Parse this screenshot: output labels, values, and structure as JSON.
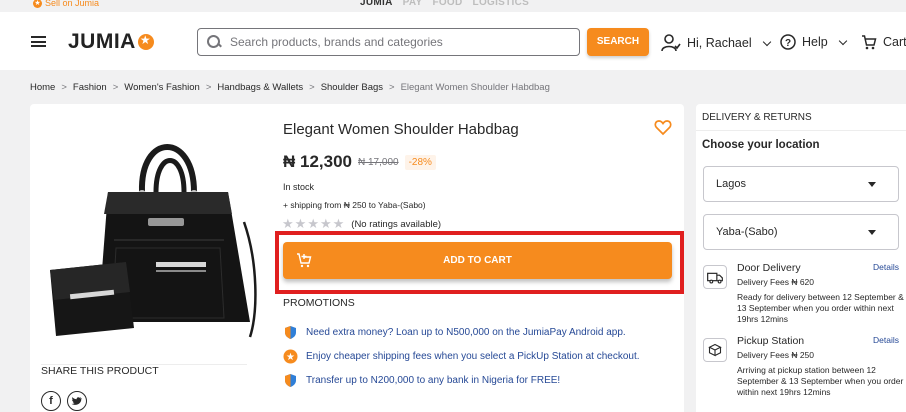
{
  "topbar": {
    "sell_label": "Sell on Jumia",
    "brands": [
      "JUMIA",
      "PAY",
      "FOOD",
      "LOGISTICS"
    ]
  },
  "header": {
    "logo": "JUMIA",
    "search_placeholder": "Search products, brands and categories",
    "search_button": "SEARCH",
    "account_label": "Hi, Rachael",
    "help_label": "Help",
    "cart_label": "Cart"
  },
  "breadcrumb": [
    "Home",
    "Fashion",
    "Women's Fashion",
    "Handbags & Wallets",
    "Shoulder Bags",
    "Elegant Women Shoulder Habdbag"
  ],
  "product": {
    "title": "Elegant Women Shoulder Habdbag",
    "price": "₦ 12,300",
    "old_price": "₦ 17,000",
    "discount": "-28%",
    "stock": "In stock",
    "shipping": "+ shipping from ₦ 250 to Yaba-(Sabo)",
    "rating_stars": 0,
    "rating_text": "(No ratings available)",
    "add_to_cart": "ADD TO CART",
    "share_title": "SHARE THIS PRODUCT"
  },
  "promotions": {
    "title": "PROMOTIONS",
    "items": [
      {
        "icon": "shield-icon",
        "text": "Need extra money? Loan up to N500,000 on the JumiaPay Android app."
      },
      {
        "icon": "star-icon",
        "text": "Enjoy cheaper shipping fees when you select a PickUp Station at checkout."
      },
      {
        "icon": "shield-icon",
        "text": "Transfer up to N200,000 to any bank in Nigeria for FREE!"
      }
    ]
  },
  "delivery": {
    "title": "DELIVERY & RETURNS",
    "choose_location": "Choose your location",
    "state": "Lagos",
    "city": "Yaba-(Sabo)",
    "options": [
      {
        "icon": "truck-icon",
        "name": "Door Delivery",
        "details": "Details",
        "fee": "Delivery Fees ₦ 620",
        "description": "Ready for delivery between 12 September & 13 September when you order within next 19hrs 12mins"
      },
      {
        "icon": "pickup-box-icon",
        "name": "Pickup Station",
        "details": "Details",
        "fee": "Delivery Fees ₦ 250",
        "description": "Arriving at pickup station between 12 September & 13 September when you order within next 19hrs 12mins"
      }
    ]
  },
  "colors": {
    "accent": "#f68b1e",
    "highlight_frame": "#e01f1f",
    "link": "#264996"
  }
}
